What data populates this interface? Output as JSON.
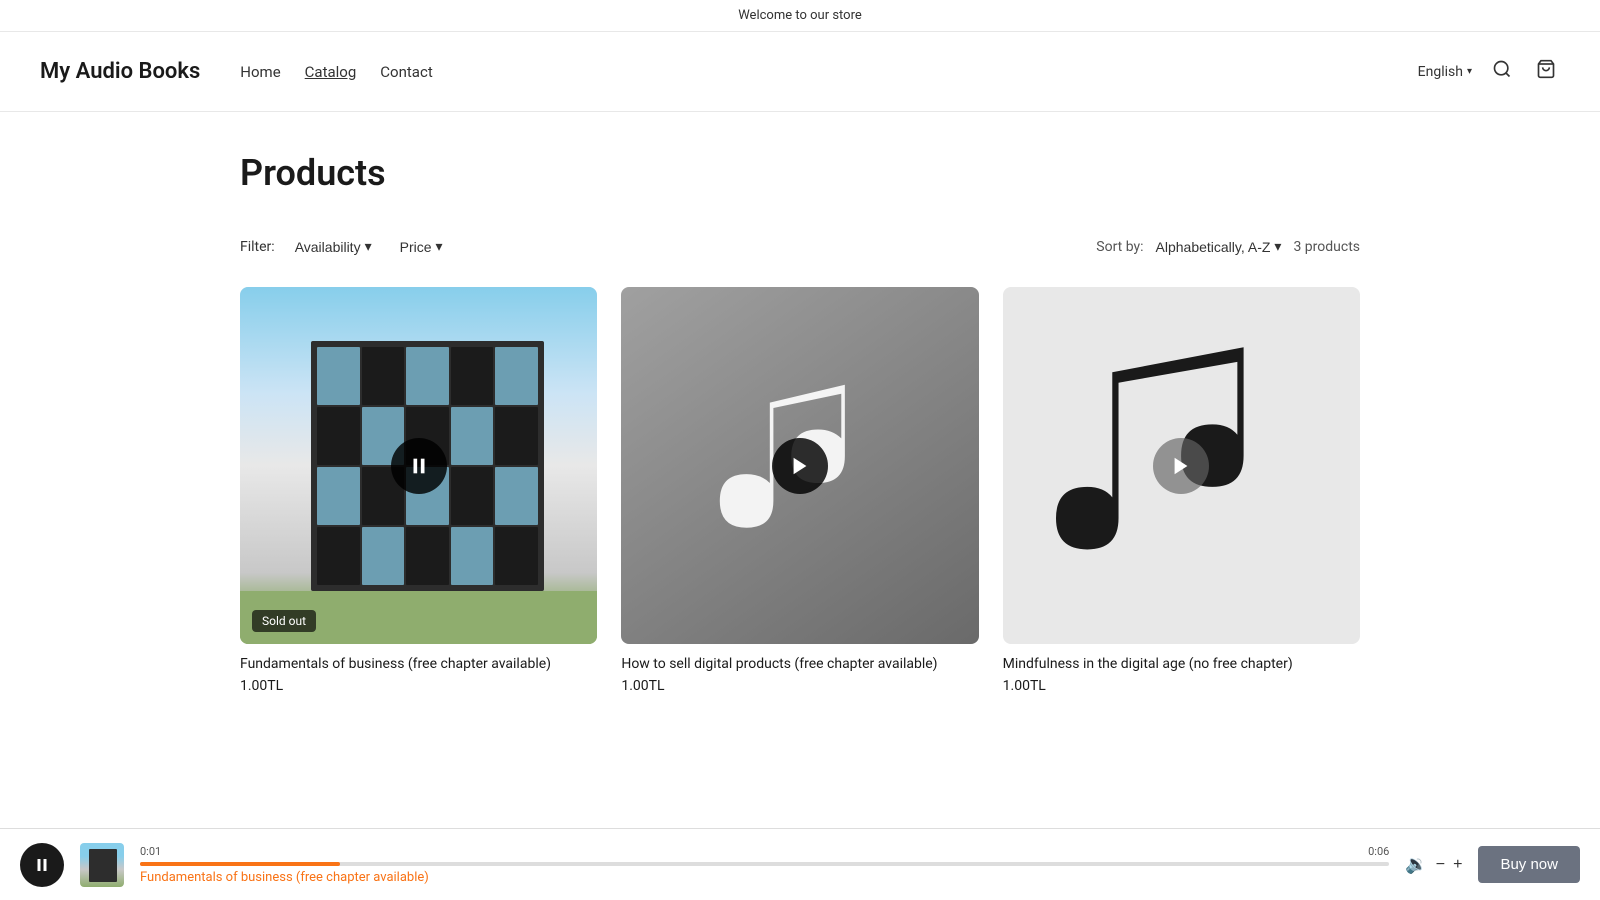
{
  "banner": {
    "text": "Welcome to our store"
  },
  "header": {
    "title": "My Audio Books",
    "nav": [
      {
        "label": "Home",
        "active": false
      },
      {
        "label": "Catalog",
        "active": true
      },
      {
        "label": "Contact",
        "active": false
      }
    ],
    "lang": "English",
    "search_aria": "Search",
    "cart_aria": "Cart"
  },
  "page": {
    "title": "Products"
  },
  "filter": {
    "label": "Filter:",
    "availability": "Availability",
    "price": "Price",
    "sort_label": "Sort by:",
    "sort_value": "Alphabetically, A-Z",
    "product_count": "3 products"
  },
  "products": [
    {
      "id": "p1",
      "name": "Fundamentals of business (free chapter available)",
      "price": "1.00TL",
      "sold_out": true,
      "type": "building",
      "playing": true
    },
    {
      "id": "p2",
      "name": "How to sell digital products (free chapter available)",
      "price": "1.00TL",
      "sold_out": false,
      "type": "music_dark",
      "playing": false
    },
    {
      "id": "p3",
      "name": "Mindfulness in the digital age (no free chapter)",
      "price": "1.00TL",
      "sold_out": false,
      "type": "music_light",
      "playing": false
    }
  ],
  "player": {
    "current_time": "0:01",
    "total_time": "0:06",
    "progress_pct": 16,
    "title": "Fundamentals of business (free chapter available)",
    "buy_now": "Buy now",
    "vol_minus": "−",
    "vol_plus": "+"
  }
}
